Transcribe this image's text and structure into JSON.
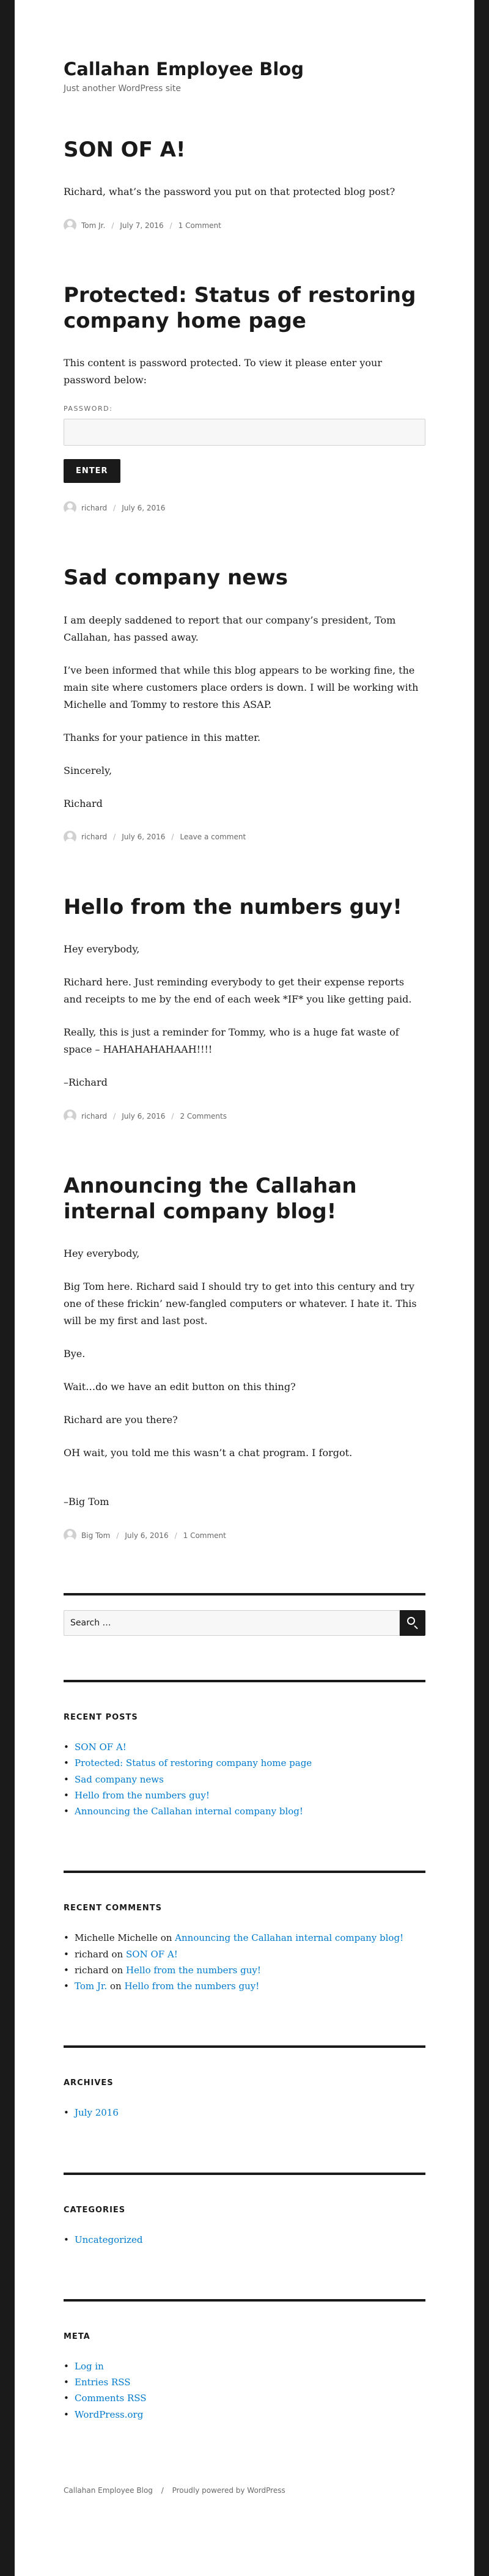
{
  "site": {
    "title": "Callahan Employee Blog",
    "description": "Just another WordPress site"
  },
  "posts": [
    {
      "title": "SON OF A!",
      "paragraphs": [
        "Richard, what’s the password you put on that protected blog post?"
      ],
      "author": "Tom Jr.",
      "date": "July 7, 2016",
      "comments": "1 Comment"
    },
    {
      "title": "Protected: Status of restoring company home page",
      "paragraphs": [
        "This content is password protected. To view it please enter your password below:"
      ],
      "password_label": "PASSWORD:",
      "enter_label": "ENTER",
      "author": "richard",
      "date": "July 6, 2016"
    },
    {
      "title": "Sad company news",
      "paragraphs": [
        "I am deeply saddened to report that our company’s president, Tom Callahan, has passed away.",
        "I’ve been informed that while this blog appears to be working fine, the main site where customers place orders is down.  I will be working with Michelle and Tommy to restore this ASAP.",
        "Thanks for your patience in this matter.",
        "Sincerely,",
        "Richard"
      ],
      "author": "richard",
      "date": "July 6, 2016",
      "comments": "Leave a comment"
    },
    {
      "title": "Hello from the numbers guy!",
      "paragraphs": [
        "Hey everybody,",
        "Richard here.  Just reminding everybody to get their expense reports and receipts to me by the end of each week *IF* you like getting paid.",
        "Really, this is just a reminder for Tommy, who is a huge fat waste of space – HAHAHAHAHAAH!!!!",
        "–Richard"
      ],
      "author": "richard",
      "date": "July 6, 2016",
      "comments": "2 Comments"
    },
    {
      "title": "Announcing the Callahan internal company blog!",
      "paragraphs": [
        "Hey everybody,",
        "Big Tom here.  Richard said I should try to get into this century and try one of these frickin’ new-fangled computers or whatever.  I hate it.  This will be my first and last post.",
        "Bye.",
        "Wait…do we have an edit button on this thing?",
        "Richard are you there?",
        "OH wait, you told me this wasn’t a chat program.  I forgot.",
        "–Big Tom"
      ],
      "author": "Big Tom",
      "date": "July 6, 2016",
      "comments": "1 Comment"
    }
  ],
  "search": {
    "placeholder": "Search …"
  },
  "recent_posts": {
    "title": "RECENT POSTS",
    "items": [
      "SON OF A!",
      "Protected: Status of restoring company home page",
      "Sad company news",
      "Hello from the numbers guy!",
      "Announcing the Callahan internal company blog!"
    ]
  },
  "recent_comments": {
    "title": "RECENT COMMENTS",
    "items": [
      {
        "author": "Michelle Michelle",
        "on": "on",
        "post": "Announcing the Callahan internal company blog!",
        "author_link": false
      },
      {
        "author": "richard",
        "on": "on",
        "post": "SON OF A!",
        "author_link": false
      },
      {
        "author": "richard",
        "on": "on",
        "post": "Hello from the numbers guy!",
        "author_link": false
      },
      {
        "author": "Tom Jr.",
        "on": "on",
        "post": "Hello from the numbers guy!",
        "author_link": true
      }
    ]
  },
  "archives": {
    "title": "ARCHIVES",
    "items": [
      "July 2016"
    ]
  },
  "categories": {
    "title": "CATEGORIES",
    "items": [
      "Uncategorized"
    ]
  },
  "meta": {
    "title": "META",
    "items": [
      "Log in",
      "Entries RSS",
      "Comments RSS",
      "WordPress.org"
    ]
  },
  "footer": {
    "site": "Callahan Employee Blog",
    "powered": "Proudly powered by WordPress"
  },
  "colors": {
    "link": "#007acc",
    "text": "#1a1a1a",
    "border": "#1a1a1a"
  }
}
